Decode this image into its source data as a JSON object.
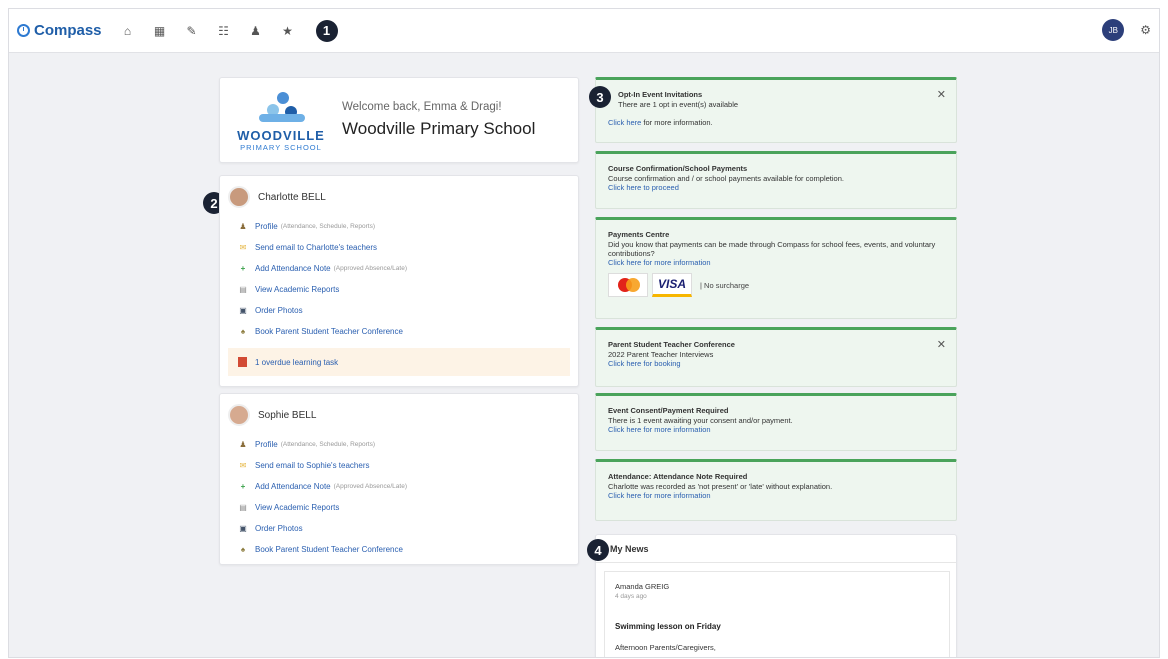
{
  "topbar": {
    "brand": "Compass",
    "nav_icons": [
      "home-icon",
      "calendar-icon",
      "pencil-icon",
      "grid-icon",
      "people-icon",
      "star-icon"
    ],
    "callout": "1",
    "avatar_initials": "JB",
    "settings_icon": "gear-icon"
  },
  "school": {
    "logo_name": "WOODVILLE",
    "logo_sub": "PRIMARY SCHOOL",
    "welcome": "Welcome back, Emma & Dragi!",
    "name": "Woodville Primary School"
  },
  "callouts": {
    "c2": "2",
    "c3": "3",
    "c4": "4"
  },
  "students": [
    {
      "name": "Charlotte BELL",
      "links": [
        {
          "icon": "profile-icon",
          "label": "Profile",
          "note": "(Attendance, Schedule, Reports)"
        },
        {
          "icon": "email-icon",
          "label": "Send email to Charlotte's teachers",
          "note": ""
        },
        {
          "icon": "plus-icon",
          "label": "Add Attendance Note",
          "note": "(Approved Absence/Late)"
        },
        {
          "icon": "report-icon",
          "label": "View Academic Reports",
          "note": ""
        },
        {
          "icon": "photo-icon",
          "label": "Order Photos",
          "note": ""
        },
        {
          "icon": "conference-icon",
          "label": "Book Parent Student Teacher Conference",
          "note": ""
        }
      ],
      "overdue": "1 overdue learning task"
    },
    {
      "name": "Sophie BELL",
      "links": [
        {
          "icon": "profile-icon",
          "label": "Profile",
          "note": "(Attendance, Schedule, Reports)"
        },
        {
          "icon": "email-icon",
          "label": "Send email to Sophie's teachers",
          "note": ""
        },
        {
          "icon": "plus-icon",
          "label": "Add Attendance Note",
          "note": "(Approved Absence/Late)"
        },
        {
          "icon": "report-icon",
          "label": "View Academic Reports",
          "note": ""
        },
        {
          "icon": "photo-icon",
          "label": "Order Photos",
          "note": ""
        },
        {
          "icon": "conference-icon",
          "label": "Book Parent Student Teacher Conference",
          "note": ""
        }
      ]
    }
  ],
  "notices": [
    {
      "title": "Opt-In Event Invitations",
      "body": "There are 1 opt in event(s) available",
      "link": "Click here",
      "link_suffix": " for more information.",
      "closable": true
    },
    {
      "title": "Course Confirmation/School Payments",
      "body": "Course confirmation and / or school payments available for completion.",
      "link": "Click here to proceed",
      "link_suffix": "",
      "closable": false
    },
    {
      "title": "Payments Centre",
      "body": "Did you know that payments can be made through Compass for school fees, events, and voluntary contributions?",
      "link": "Click here for more information",
      "link_suffix": "",
      "closable": false,
      "card_visa": "VISA",
      "surcharge": "No surcharge"
    },
    {
      "title": "Parent Student Teacher Conference",
      "body": "2022 Parent Teacher Interviews",
      "link": "Click here for booking",
      "link_suffix": "",
      "closable": true
    },
    {
      "title": "Event Consent/Payment Required",
      "body": "There is 1 event awaiting your consent and/or payment.",
      "link": "Click here for more information",
      "link_suffix": "",
      "closable": false
    },
    {
      "title": "Attendance: Attendance Note Required",
      "body": "Charlotte was recorded as 'not present' or 'late' without explanation.",
      "link": "Click here for more information",
      "link_suffix": "",
      "closable": false
    }
  ],
  "news": {
    "heading": "My News",
    "author": "Amanda GREIG",
    "date": "4 days ago",
    "title": "Swimming lesson on Friday",
    "excerpt": "Afternoon Parents/Caregivers,"
  },
  "colors": {
    "brand": "#1f5ea8",
    "notice_accent": "#4aa35b",
    "link": "#2a5fb0"
  }
}
